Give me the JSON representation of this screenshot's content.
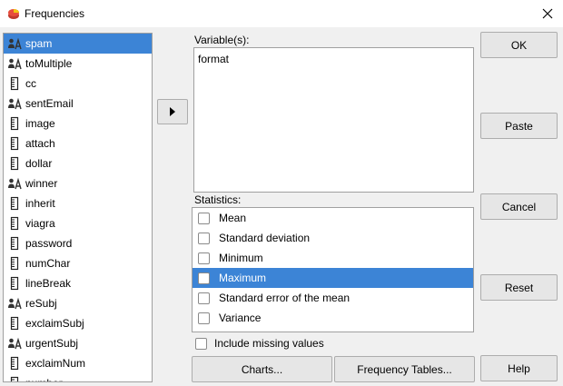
{
  "window": {
    "title": "Frequencies",
    "close_label": "×"
  },
  "variables": [
    {
      "label": "spam",
      "icon": "nominal-icon",
      "selected": true
    },
    {
      "label": "toMultiple",
      "icon": "nominal-icon",
      "selected": false
    },
    {
      "label": "cc",
      "icon": "scale-icon",
      "selected": false
    },
    {
      "label": "sentEmail",
      "icon": "nominal-icon",
      "selected": false
    },
    {
      "label": "image",
      "icon": "scale-icon",
      "selected": false
    },
    {
      "label": "attach",
      "icon": "scale-icon",
      "selected": false
    },
    {
      "label": "dollar",
      "icon": "scale-icon",
      "selected": false
    },
    {
      "label": "winner",
      "icon": "nominal-icon",
      "selected": false
    },
    {
      "label": "inherit",
      "icon": "scale-icon",
      "selected": false
    },
    {
      "label": "viagra",
      "icon": "scale-icon",
      "selected": false
    },
    {
      "label": "password",
      "icon": "scale-icon",
      "selected": false
    },
    {
      "label": "numChar",
      "icon": "scale-icon",
      "selected": false
    },
    {
      "label": "lineBreak",
      "icon": "scale-icon",
      "selected": false
    },
    {
      "label": "reSubj",
      "icon": "nominal-icon",
      "selected": false
    },
    {
      "label": "exclaimSubj",
      "icon": "scale-icon",
      "selected": false
    },
    {
      "label": "urgentSubj",
      "icon": "nominal-icon",
      "selected": false
    },
    {
      "label": "exclaimNum",
      "icon": "scale-icon",
      "selected": false
    },
    {
      "label": "number",
      "icon": "scale-icon",
      "selected": false
    }
  ],
  "move_button": {
    "icon": "arrow-right-icon"
  },
  "target": {
    "label": "Variable(s):",
    "items": [
      "format"
    ]
  },
  "statistics": {
    "label": "Statistics:",
    "items": [
      {
        "label": "Mean",
        "checked": false,
        "selected": false
      },
      {
        "label": "Standard deviation",
        "checked": false,
        "selected": false
      },
      {
        "label": "Minimum",
        "checked": false,
        "selected": false
      },
      {
        "label": "Maximum",
        "checked": false,
        "selected": true
      },
      {
        "label": "Standard error of the mean",
        "checked": false,
        "selected": false
      },
      {
        "label": "Variance",
        "checked": false,
        "selected": false
      }
    ]
  },
  "include_missing": {
    "label": "Include missing values",
    "checked": false
  },
  "buttons": {
    "ok": "OK",
    "paste": "Paste",
    "cancel": "Cancel",
    "reset": "Reset",
    "help": "Help",
    "charts": "Charts...",
    "frequency_tables": "Frequency Tables..."
  },
  "colors": {
    "selection": "#3c84d6",
    "nominal_icon": "#333333",
    "scale_icon": "#222222"
  }
}
